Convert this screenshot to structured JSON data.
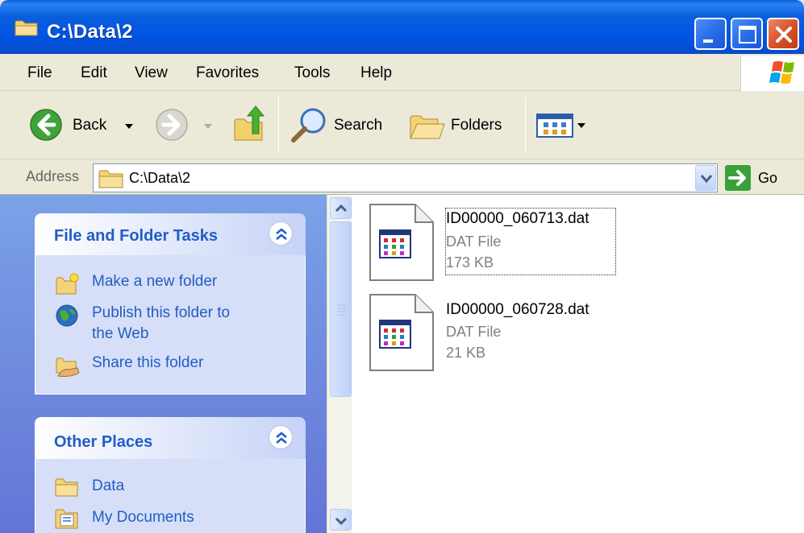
{
  "window": {
    "title": "C:\\Data\\2",
    "controls": {
      "minimize": "minimize",
      "maximize": "maximize",
      "close": "close"
    }
  },
  "menubar": {
    "items": [
      "File",
      "Edit",
      "View",
      "Favorites",
      "Tools",
      "Help"
    ]
  },
  "toolbar": {
    "back_label": "Back",
    "search_label": "Search",
    "folders_label": "Folders"
  },
  "address": {
    "label": "Address",
    "value": "C:\\Data\\2",
    "go_label": "Go"
  },
  "taskpane": {
    "file_tasks": {
      "title": "File and Folder Tasks",
      "items": [
        {
          "label": "Make a new folder",
          "icon": "new-folder-icon"
        },
        {
          "label": "Publish this folder to the Web",
          "line1": "Publish this folder to",
          "line2": "the Web",
          "icon": "globe-icon"
        },
        {
          "label": "Share this folder",
          "icon": "share-folder-icon"
        }
      ]
    },
    "other_places": {
      "title": "Other Places",
      "items": [
        {
          "label": "Data",
          "icon": "folder-icon"
        },
        {
          "label": "My Documents",
          "icon": "my-documents-icon"
        }
      ]
    }
  },
  "files": [
    {
      "name": "ID00000_060713.dat",
      "type": "DAT File",
      "size": "173 KB",
      "selected": true
    },
    {
      "name": "ID00000_060728.dat",
      "type": "DAT File",
      "size": "21 KB",
      "selected": false
    }
  ],
  "colors": {
    "titlebar": "#0054e3",
    "taskpane_bg": "#6375d6",
    "link": "#215dc6"
  }
}
